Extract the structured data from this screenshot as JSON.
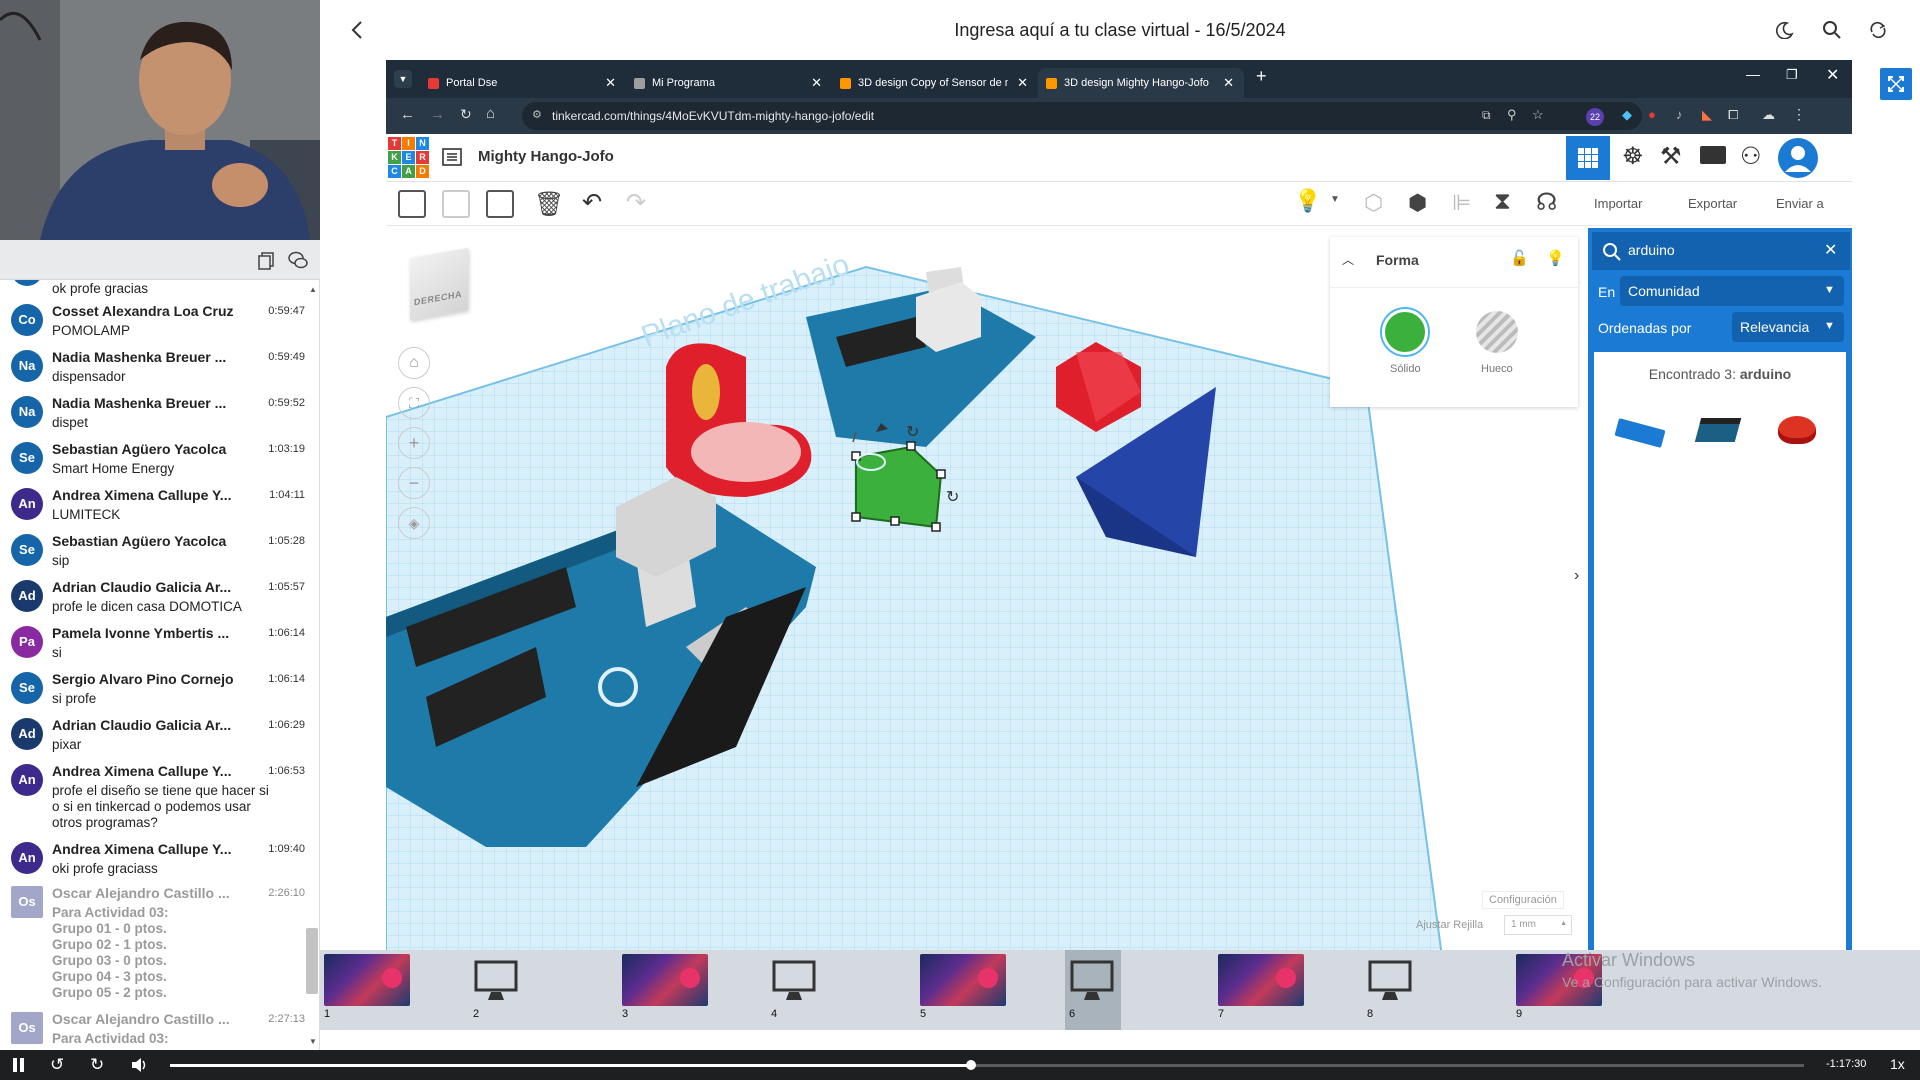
{
  "header": {
    "title": "Ingresa aquí a tu clase virtual - 16/5/2024",
    "back_icon": "chevron-left-icon",
    "icons": [
      "moon-icon",
      "search-icon",
      "refresh-icon"
    ]
  },
  "chat": {
    "first_text": "ok profe gracias",
    "messages": [
      {
        "initials": "Co",
        "name": "Cosset Alexandra Loa Cruz",
        "time": "0:59:47",
        "text": "POMOLAMP",
        "color": "#1565a8"
      },
      {
        "initials": "Na",
        "name": "Nadia Mashenka Breuer ...",
        "time": "0:59:49",
        "text": "dispensador",
        "color": "#1565a8"
      },
      {
        "initials": "Na",
        "name": "Nadia Mashenka Breuer ...",
        "time": "0:59:52",
        "text": "dispet",
        "color": "#1565a8"
      },
      {
        "initials": "Se",
        "name": "Sebastian Agüero Yacolca",
        "time": "1:03:19",
        "text": "Smart Home Energy",
        "color": "#1565a8"
      },
      {
        "initials": "An",
        "name": "Andrea Ximena Callupe Y...",
        "time": "1:04:11",
        "text": "LUMITECK",
        "color": "#3d2a8c"
      },
      {
        "initials": "Se",
        "name": "Sebastian Agüero Yacolca",
        "time": "1:05:28",
        "text": "sip",
        "color": "#1565a8"
      },
      {
        "initials": "Ad",
        "name": "Adrian Claudio Galicia Ar...",
        "time": "1:05:57",
        "text": "profe le dicen casa DOMOTICA",
        "color": "#1a3a6e"
      },
      {
        "initials": "Pa",
        "name": "Pamela Ivonne Ymbertis ...",
        "time": "1:06:14",
        "text": "si",
        "color": "#8a2aa0"
      },
      {
        "initials": "Se",
        "name": "Sergio Alvaro Pino Cornejo",
        "time": "1:06:14",
        "text": "si profe",
        "color": "#1565a8"
      },
      {
        "initials": "Ad",
        "name": "Adrian Claudio Galicia Ar...",
        "time": "1:06:29",
        "text": "pixar",
        "color": "#1a3a6e"
      },
      {
        "initials": "An",
        "name": "Andrea Ximena Callupe Y...",
        "time": "1:06:53",
        "text": "profe el diseño se tiene que hacer si\no si en tinkercad o podemos usar\notros programas?",
        "color": "#3d2a8c"
      },
      {
        "initials": "An",
        "name": "Andrea Ximena Callupe Y...",
        "time": "1:09:40",
        "text": "oki profe graciass",
        "color": "#3d2a8c"
      },
      {
        "initials": "Os",
        "name": "Oscar Alejandro Castillo ...",
        "time": "2:26:10",
        "text": "Para Actividad 03:\nGrupo 01 - 0 ptos.\nGrupo 02 - 1 ptos.\nGrupo 03 - 0 ptos.\nGrupo 04 - 3 ptos.\nGrupo 05 - 2 ptos.",
        "color": "#a2a6c8",
        "grey": true
      },
      {
        "initials": "Os",
        "name": "Oscar Alejandro Castillo ...",
        "time": "2:27:13",
        "text": "Para Actividad 03:",
        "color": "#a2a6c8",
        "grey": true
      }
    ]
  },
  "browser": {
    "tabs": [
      {
        "label": "Portal Dse",
        "active": false
      },
      {
        "label": "Mi Programa",
        "active": false
      },
      {
        "label": "3D design Copy of Sensor de m",
        "active": false
      },
      {
        "label": "3D design Mighty Hango-Jofo",
        "active": true
      }
    ],
    "new_tab": "+",
    "url": "tinkercad.com/things/4MoEvKVUTdm-mighty-hango-jofo/edit",
    "ext_badge": "22"
  },
  "tinkercad": {
    "logo_letters": [
      "T",
      "I",
      "N",
      "K",
      "E",
      "R",
      "C",
      "A",
      "D"
    ],
    "design_name": "Mighty Hango-Jofo",
    "import_label": "Importar",
    "export_label": "Exportar",
    "send_label": "Enviar a",
    "viewcube_label": "DERECHA",
    "workplane_text": "Plano de trabajo",
    "shape_panel": {
      "title": "Forma",
      "solid_label": "Sólido",
      "hole_label": "Hueco",
      "solid_color": "#3cb03c"
    },
    "search": {
      "query": "arduino",
      "in_label": "En",
      "in_value": "Comunidad",
      "sort_label": "Ordenadas por",
      "sort_value": "Relevancia",
      "found_prefix": "Encontrado 3:",
      "found_term": "arduino"
    },
    "config_label": "Configuración",
    "snap_label": "Ajustar Rejilla",
    "snap_value": "1 mm"
  },
  "windows_watermark": {
    "line1": "Activar Windows",
    "line2": "Ve a Configuración para activar Windows."
  },
  "thumbnails": [
    {
      "num": "1",
      "kind": "image"
    },
    {
      "num": "2",
      "kind": "monitor"
    },
    {
      "num": "3",
      "kind": "image"
    },
    {
      "num": "4",
      "kind": "monitor"
    },
    {
      "num": "5",
      "kind": "image"
    },
    {
      "num": "6",
      "kind": "monitor",
      "selected": true
    },
    {
      "num": "7",
      "kind": "image"
    },
    {
      "num": "8",
      "kind": "monitor"
    },
    {
      "num": "9",
      "kind": "image"
    }
  ],
  "player": {
    "time_remaining": "-1:17:30",
    "speed": "1x",
    "progress": 0.49
  }
}
